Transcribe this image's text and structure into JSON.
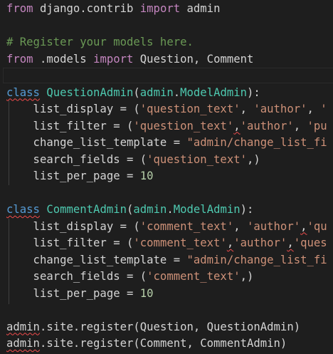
{
  "theme": {
    "background": "#1e1e1e",
    "keyword": "#c586c0",
    "storage": "#569cd6",
    "class_name": "#4ec9b0",
    "identifier": "#9cdcfe",
    "string": "#ce9178",
    "number": "#b5cea8",
    "comment": "#6a9955",
    "function": "#dcdcaa",
    "plain": "#d4d4d4"
  },
  "code_lines": [
    [
      {
        "t": "from",
        "c": "keyword"
      },
      {
        "t": " django.contrib ",
        "c": "plain"
      },
      {
        "t": "import",
        "c": "keyword"
      },
      {
        "t": " admin",
        "c": "plain"
      }
    ],
    [],
    [
      {
        "t": "# Register your models here.",
        "c": "comment"
      }
    ],
    [
      {
        "t": "from",
        "c": "keyword"
      },
      {
        "t": " .models ",
        "c": "plain"
      },
      {
        "t": "import",
        "c": "keyword"
      },
      {
        "t": " Question, Comment",
        "c": "plain"
      }
    ],
    [],
    [
      {
        "t": "class",
        "c": "storage",
        "sq": true
      },
      {
        "t": " ",
        "c": "plain"
      },
      {
        "t": "QuestionAdmin",
        "c": "class_name"
      },
      {
        "t": "(",
        "c": "plain"
      },
      {
        "t": "admin",
        "c": "class_name"
      },
      {
        "t": ".",
        "c": "plain"
      },
      {
        "t": "ModelAdmin",
        "c": "class_name"
      },
      {
        "t": "):",
        "c": "plain"
      }
    ],
    [
      {
        "t": "    list_display = (",
        "c": "plain"
      },
      {
        "t": "'question_text'",
        "c": "string"
      },
      {
        "t": ", ",
        "c": "plain"
      },
      {
        "t": "'author'",
        "c": "string"
      },
      {
        "t": ", ",
        "c": "plain"
      },
      {
        "t": "'",
        "c": "string"
      }
    ],
    [
      {
        "t": "    list_filter = (",
        "c": "plain"
      },
      {
        "t": "'question_text'",
        "c": "string"
      },
      {
        "t": ",",
        "c": "plain",
        "sq": true
      },
      {
        "t": "'author'",
        "c": "string"
      },
      {
        "t": ", ",
        "c": "plain"
      },
      {
        "t": "'pu",
        "c": "string"
      }
    ],
    [
      {
        "t": "    change_list_template = ",
        "c": "plain"
      },
      {
        "t": "\"admin/change_list_fi",
        "c": "string"
      }
    ],
    [
      {
        "t": "    search_fields = (",
        "c": "plain"
      },
      {
        "t": "'question_text'",
        "c": "string"
      },
      {
        "t": ",)",
        "c": "plain"
      }
    ],
    [
      {
        "t": "    list_per_page = ",
        "c": "plain"
      },
      {
        "t": "10",
        "c": "number"
      }
    ],
    [],
    [
      {
        "t": "class",
        "c": "storage",
        "sq": true
      },
      {
        "t": " ",
        "c": "plain"
      },
      {
        "t": "CommentAdmin",
        "c": "class_name"
      },
      {
        "t": "(",
        "c": "plain"
      },
      {
        "t": "admin",
        "c": "class_name"
      },
      {
        "t": ".",
        "c": "plain"
      },
      {
        "t": "ModelAdmin",
        "c": "class_name"
      },
      {
        "t": "):",
        "c": "plain"
      }
    ],
    [
      {
        "t": "    list_display = (",
        "c": "plain"
      },
      {
        "t": "'comment_text'",
        "c": "string"
      },
      {
        "t": ", ",
        "c": "plain"
      },
      {
        "t": "'author'",
        "c": "string"
      },
      {
        "t": ",",
        "c": "plain",
        "sq": true
      },
      {
        "t": "'qu",
        "c": "string"
      }
    ],
    [
      {
        "t": "    list_filter = (",
        "c": "plain"
      },
      {
        "t": "'comment_text'",
        "c": "string"
      },
      {
        "t": ",",
        "c": "plain",
        "sq": true
      },
      {
        "t": "'author'",
        "c": "string"
      },
      {
        "t": ",",
        "c": "plain",
        "sq": true
      },
      {
        "t": "'ques",
        "c": "string"
      }
    ],
    [
      {
        "t": "    change_list_template = ",
        "c": "plain"
      },
      {
        "t": "\"admin/change_list_fi",
        "c": "string"
      }
    ],
    [
      {
        "t": "    search_fields = (",
        "c": "plain"
      },
      {
        "t": "'comment_text'",
        "c": "string"
      },
      {
        "t": ",)",
        "c": "plain"
      }
    ],
    [
      {
        "t": "    list_per_page = ",
        "c": "plain"
      },
      {
        "t": "10",
        "c": "number"
      }
    ],
    [],
    [
      {
        "t": "admin",
        "c": "plain",
        "sq": true
      },
      {
        "t": ".site.register(Question, QuestionAdmin)",
        "c": "plain"
      }
    ],
    [
      {
        "t": "admin",
        "c": "plain",
        "sq": true
      },
      {
        "t": ".site.register(Comment, CommentAdmin)",
        "c": "plain"
      }
    ]
  ]
}
